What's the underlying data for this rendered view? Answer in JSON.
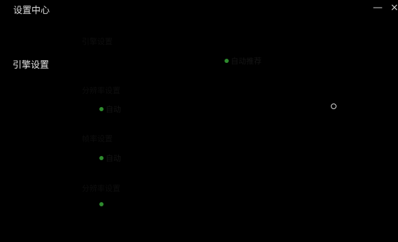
{
  "window": {
    "title": "设置中心",
    "minimize_icon": "minimize-icon",
    "close_icon": "close-icon",
    "minimize_label": "—",
    "close_label": "×"
  },
  "sidebar": {
    "items": [
      {
        "label": "引擎设置"
      }
    ]
  },
  "sections": [
    {
      "label": "引擎设置",
      "options": [
        {
          "label": "",
          "selected": false
        },
        {
          "label": "",
          "selected": false
        },
        {
          "label": "自动推荐",
          "selected": true
        }
      ]
    },
    {
      "label": "分辨率设置",
      "options": [
        {
          "label": "自动",
          "selected": true
        },
        {
          "label": "",
          "selected": false
        },
        {
          "label": "",
          "selected": false
        },
        {
          "label": "",
          "selected": false
        },
        {
          "label": "",
          "selected": false
        },
        {
          "label": "",
          "selected": false,
          "ring": true
        }
      ]
    },
    {
      "label": "帧率设置",
      "options": [
        {
          "label": "自动",
          "selected": true
        },
        {
          "label": "",
          "selected": false
        },
        {
          "label": "",
          "selected": false
        },
        {
          "label": "",
          "selected": false
        },
        {
          "label": "",
          "selected": false
        }
      ]
    },
    {
      "label": "分辨率设置",
      "options": [
        {
          "label": "",
          "selected": true
        },
        {
          "label": "",
          "selected": false
        },
        {
          "label": "",
          "selected": false
        },
        {
          "label": "",
          "selected": false
        },
        {
          "label": "",
          "selected": false
        }
      ]
    },
    {
      "label": "",
      "options": []
    }
  ],
  "colors": {
    "background": "#000000",
    "title_text": "#dcdcdc",
    "sidebar_text": "#e6e6e6",
    "selected_dot": "#2e8b2e"
  }
}
